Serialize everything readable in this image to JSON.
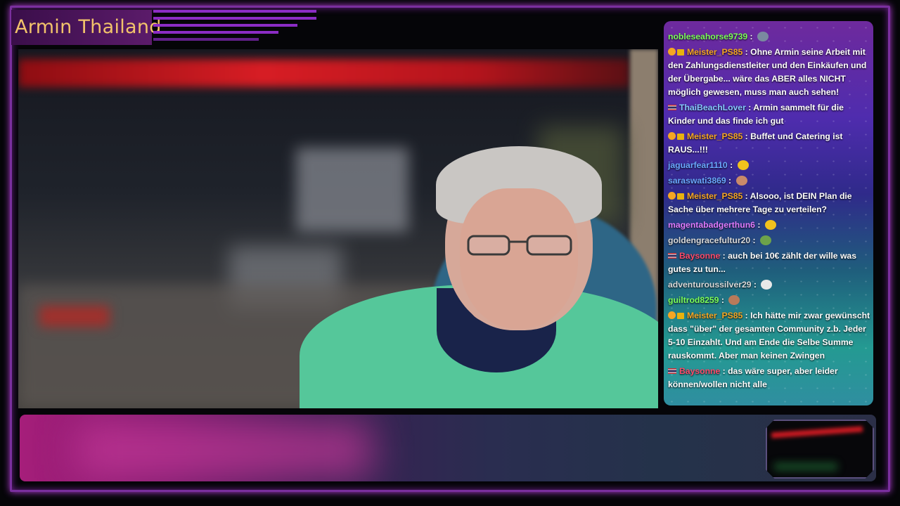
{
  "stream": {
    "title": "Armin Thailand"
  },
  "chat": {
    "messages": [
      {
        "user": "nobleseahorse9739",
        "user_color": "#7cff5a",
        "badges": [],
        "text": ""
      },
      {
        "user": "Meister_PS85",
        "user_color": "#f5a623",
        "badges": [
          "mod",
          "sub"
        ],
        "text": "Ohne Armin seine Arbeit mit den Zahlungsdienstleiter und den Einkäufen und der Übergabe... wäre das ABER alles NICHT möglich gewesen, muss man auch sehen!"
      },
      {
        "user": "ThaiBeachLover",
        "user_color": "#86c9ff",
        "badges": [
          "flag"
        ],
        "text": "Armin sammelt für die Kinder und das finde ich gut"
      },
      {
        "user": "Meister_PS85",
        "user_color": "#f5a623",
        "badges": [
          "mod",
          "sub"
        ],
        "text": "Buffet und Catering ist RAUS...!!!"
      },
      {
        "user": "jaguarfear1110",
        "user_color": "#6aa8ff",
        "badges": [],
        "text": ""
      },
      {
        "user": "saraswati3869",
        "user_color": "#6aa8ff",
        "badges": [],
        "text": ""
      },
      {
        "user": "Meister_PS85",
        "user_color": "#f5a623",
        "badges": [
          "mod",
          "sub"
        ],
        "text": "Alsooo, ist DEIN Plan die Sache über mehrere Tage zu verteilen?"
      },
      {
        "user": "magentabadgerthun6",
        "user_color": "#e07bff",
        "badges": [],
        "text": ""
      },
      {
        "user": "goldengracefultur20",
        "user_color": "#d8d8d8",
        "badges": [],
        "text": ""
      },
      {
        "user": "Baysonne",
        "user_color": "#ff4a6a",
        "badges": [
          "flag"
        ],
        "text": "auch bei 10€ zählt der wille was gutes zu tun..."
      },
      {
        "user": "adventuroussilver29",
        "user_color": "#d8d8d8",
        "badges": [],
        "text": ""
      },
      {
        "user": "guiltrod8259",
        "user_color": "#7cff5a",
        "badges": [],
        "text": ""
      },
      {
        "user": "Meister_PS85",
        "user_color": "#f5a623",
        "badges": [
          "mod",
          "sub"
        ],
        "text": "Ich hätte mir zwar gewünscht dass \"über\" der gesamten Community z.b. Jeder 5-10 Einzahlt. Und am Ende die Selbe Summe rauskommt. Aber man keinen Zwingen"
      },
      {
        "user": "Baysonne",
        "user_color": "#ff4a6a",
        "badges": [
          "flag"
        ],
        "text": "das wäre super, aber leider können/wollen nicht alle"
      }
    ],
    "separator": " : ",
    "emote_icons": [
      "car-emote-icon",
      "sun-emote-icon",
      "face-emote-icon",
      "smile-emote-icon",
      "frog-emote-icon",
      "chicken-emote-icon",
      "portrait-emote-icon"
    ]
  },
  "colors": {
    "frame": "#7a2f9e",
    "title": "#f2c36b",
    "accent": "#8b2cc4"
  }
}
